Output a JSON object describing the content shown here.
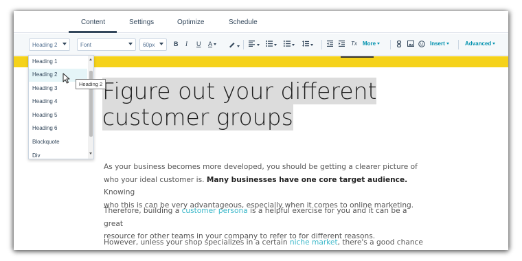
{
  "tabs": [
    {
      "label": "Content"
    },
    {
      "label": "Settings"
    },
    {
      "label": "Optimize"
    },
    {
      "label": "Schedule"
    }
  ],
  "toolbar": {
    "block_style": "Heading 2",
    "font": "Font",
    "size": "60px",
    "bold": "B",
    "italic": "I",
    "underline": "U",
    "text_color": "A",
    "clear_format": "Tx",
    "more": "More",
    "insert": "Insert",
    "advanced": "Advanced"
  },
  "dropdown": {
    "items": [
      "Heading 1",
      "Heading 2",
      "Heading 3",
      "Heading 4",
      "Heading 5",
      "Heading 6",
      "Blockquote",
      "Div"
    ],
    "selected": "Heading 2"
  },
  "tooltip": "Heading 2",
  "article": {
    "heading_line1": "Figure out your different",
    "heading_line2": "customer groups",
    "p1_l1": "As your business becomes more developed, you should be getting a clearer picture of",
    "p1_l2a": "who your ideal customer is. ",
    "p1_l2b": "Many businesses have one core target audience.",
    "p1_l2c": " Knowing",
    "p1_l3": "who this is can be very advantageous, especially when it comes to online marketing.",
    "p2_l1a": "Therefore, building a ",
    "p2_l1b": "customer persona",
    "p2_l1c": " is a helpful exercise for you and it can be a great",
    "p2_l2": "resource for other teams in your company to refer to for different reasons.",
    "p3_l1a": "However, unless your shop specializes in a certain ",
    "p3_l1b": "niche market",
    "p3_l1c": ", there's a good chance"
  },
  "colors": {
    "accent_teal": "#0091ae",
    "band_yellow": "#f5d21a",
    "link_teal": "#3ab7c9"
  }
}
